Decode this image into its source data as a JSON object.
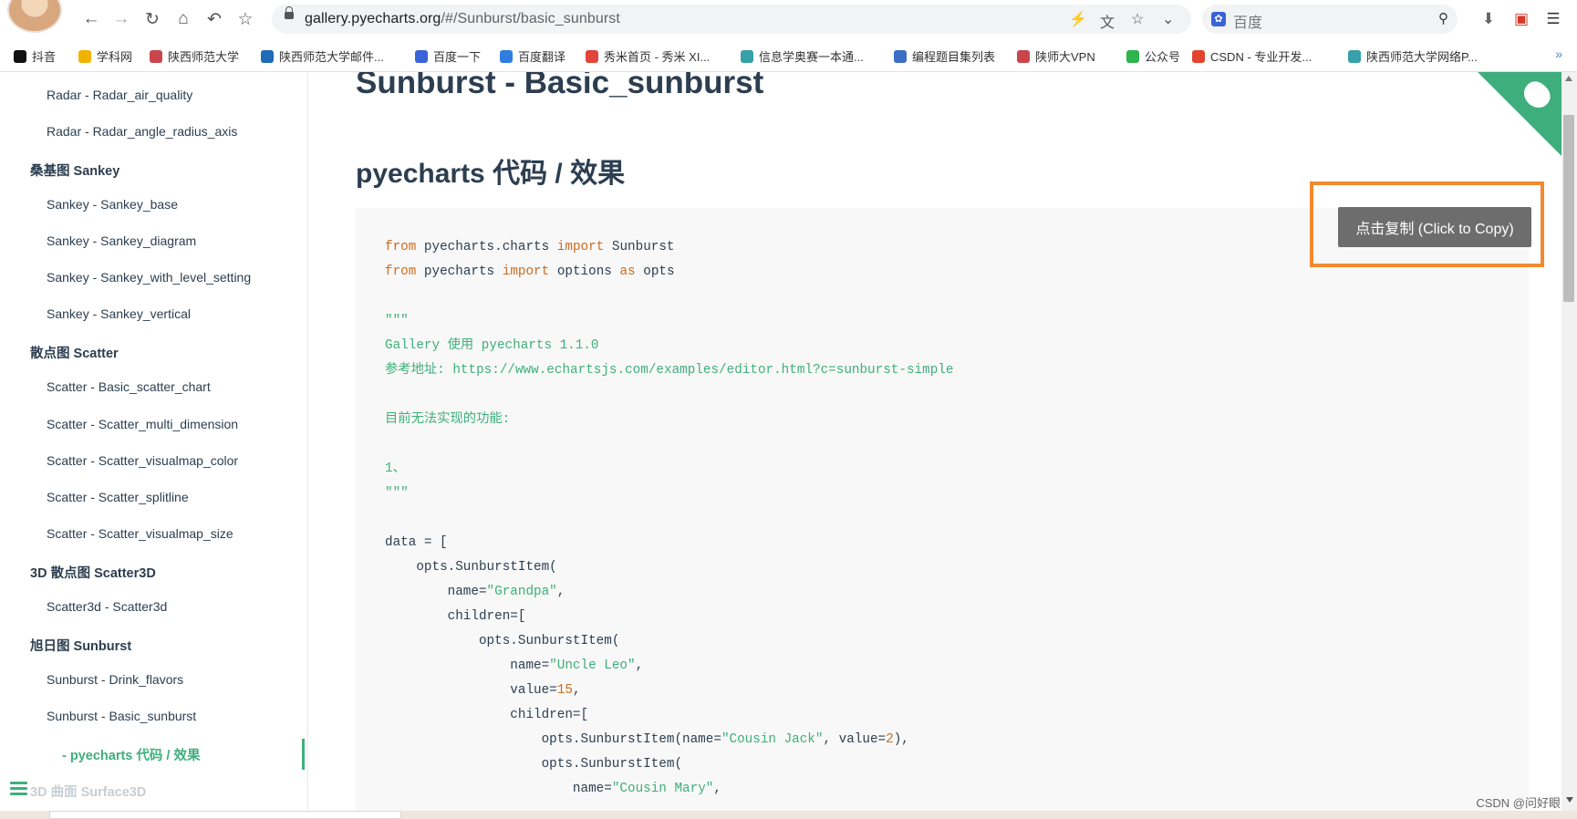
{
  "browser": {
    "url_host": "gallery.pyecharts.org",
    "url_path": "/#/Sunburst/basic_sunburst",
    "search_placeholder": "百度",
    "bookmarks": [
      {
        "label": "抖音",
        "color": "#111111"
      },
      {
        "label": "学科网",
        "color": "#f0b400"
      },
      {
        "label": "陕西师范大学",
        "color": "#c8464b"
      },
      {
        "label": "陕西师范大学邮件...",
        "color": "#1e6bb8"
      },
      {
        "label": "百度一下",
        "color": "#3a63d9"
      },
      {
        "label": "百度翻译",
        "color": "#2f7de1"
      },
      {
        "label": "秀米首页 - 秀米 XI...",
        "color": "#e0463a"
      },
      {
        "label": "信息学奥赛一本通...",
        "color": "#37a0a8"
      },
      {
        "label": "编程题目集列表",
        "color": "#3c6fc4"
      },
      {
        "label": "陕师大VPN",
        "color": "#c8464b"
      },
      {
        "label": "公众号",
        "color": "#2db44c"
      },
      {
        "label": "CSDN - 专业开发...",
        "color": "#e2442f"
      },
      {
        "label": "陕西师范大学网络P...",
        "color": "#37a0a8"
      }
    ]
  },
  "sidebar": {
    "items": [
      {
        "text": "Radar - Radar_air_quality",
        "kind": "item"
      },
      {
        "text": "Radar - Radar_angle_radius_axis",
        "kind": "item"
      },
      {
        "text": "桑基图 Sankey",
        "kind": "head"
      },
      {
        "text": "Sankey - Sankey_base",
        "kind": "item"
      },
      {
        "text": "Sankey - Sankey_diagram",
        "kind": "item"
      },
      {
        "text": "Sankey - Sankey_with_level_setting",
        "kind": "item"
      },
      {
        "text": "Sankey - Sankey_vertical",
        "kind": "item"
      },
      {
        "text": "散点图 Scatter",
        "kind": "head"
      },
      {
        "text": "Scatter - Basic_scatter_chart",
        "kind": "item"
      },
      {
        "text": "Scatter - Scatter_multi_dimension",
        "kind": "item"
      },
      {
        "text": "Scatter - Scatter_visualmap_color",
        "kind": "item"
      },
      {
        "text": "Scatter - Scatter_splitline",
        "kind": "item"
      },
      {
        "text": "Scatter - Scatter_visualmap_size",
        "kind": "item"
      },
      {
        "text": "3D 散点图 Scatter3D",
        "kind": "head"
      },
      {
        "text": "Scatter3d - Scatter3d",
        "kind": "item"
      },
      {
        "text": "旭日图 Sunburst",
        "kind": "head"
      },
      {
        "text": "Sunburst - Drink_flavors",
        "kind": "item"
      },
      {
        "text": "Sunburst - Basic_sunburst",
        "kind": "item"
      },
      {
        "text": "- pyecharts 代码 / 效果",
        "kind": "active"
      },
      {
        "text": "3D 曲面 Surface3D",
        "kind": "faded"
      }
    ]
  },
  "main": {
    "title": "Sunburst - Basic_sunburst",
    "subtitle": "pyecharts 代码 / 效果",
    "copy_label": "点击复制 (Click to Copy)"
  },
  "code": {
    "kw_from": "from",
    "kw_import": "import",
    "kw_as": "as",
    "mod_charts": "pyecharts.charts",
    "cls_sunburst": "Sunburst",
    "mod_pyecharts": "pyecharts",
    "name_options": "options",
    "alias_opts": "opts",
    "docstring_open": "\"\"\"",
    "doc_line1": "Gallery 使用 pyecharts 1.1.0",
    "doc_line2": "参考地址: https://www.echartsjs.com/examples/editor.html?c=sunburst-simple",
    "doc_line3": "目前无法实现的功能:",
    "doc_line4": "1、",
    "docstring_close": "\"\"\"",
    "data_open": "data = [",
    "item_call": "opts.SunburstItem(",
    "name_eq": "name=",
    "str_grandpa": "\"Grandpa\"",
    "children_open": "children=[",
    "str_uncle_leo": "\"Uncle Leo\"",
    "value_eq": "value=",
    "num_15": "15",
    "inline_call": "opts.SunburstItem(name=",
    "str_cousin_jack": "\"Cousin Jack\"",
    "value_sep": ", value=",
    "num_2": "2",
    "close_paren": "),",
    "str_cousin_mary": "\"Cousin Mary\"",
    "comma": ","
  },
  "watermark": "CSDN @问好眼"
}
